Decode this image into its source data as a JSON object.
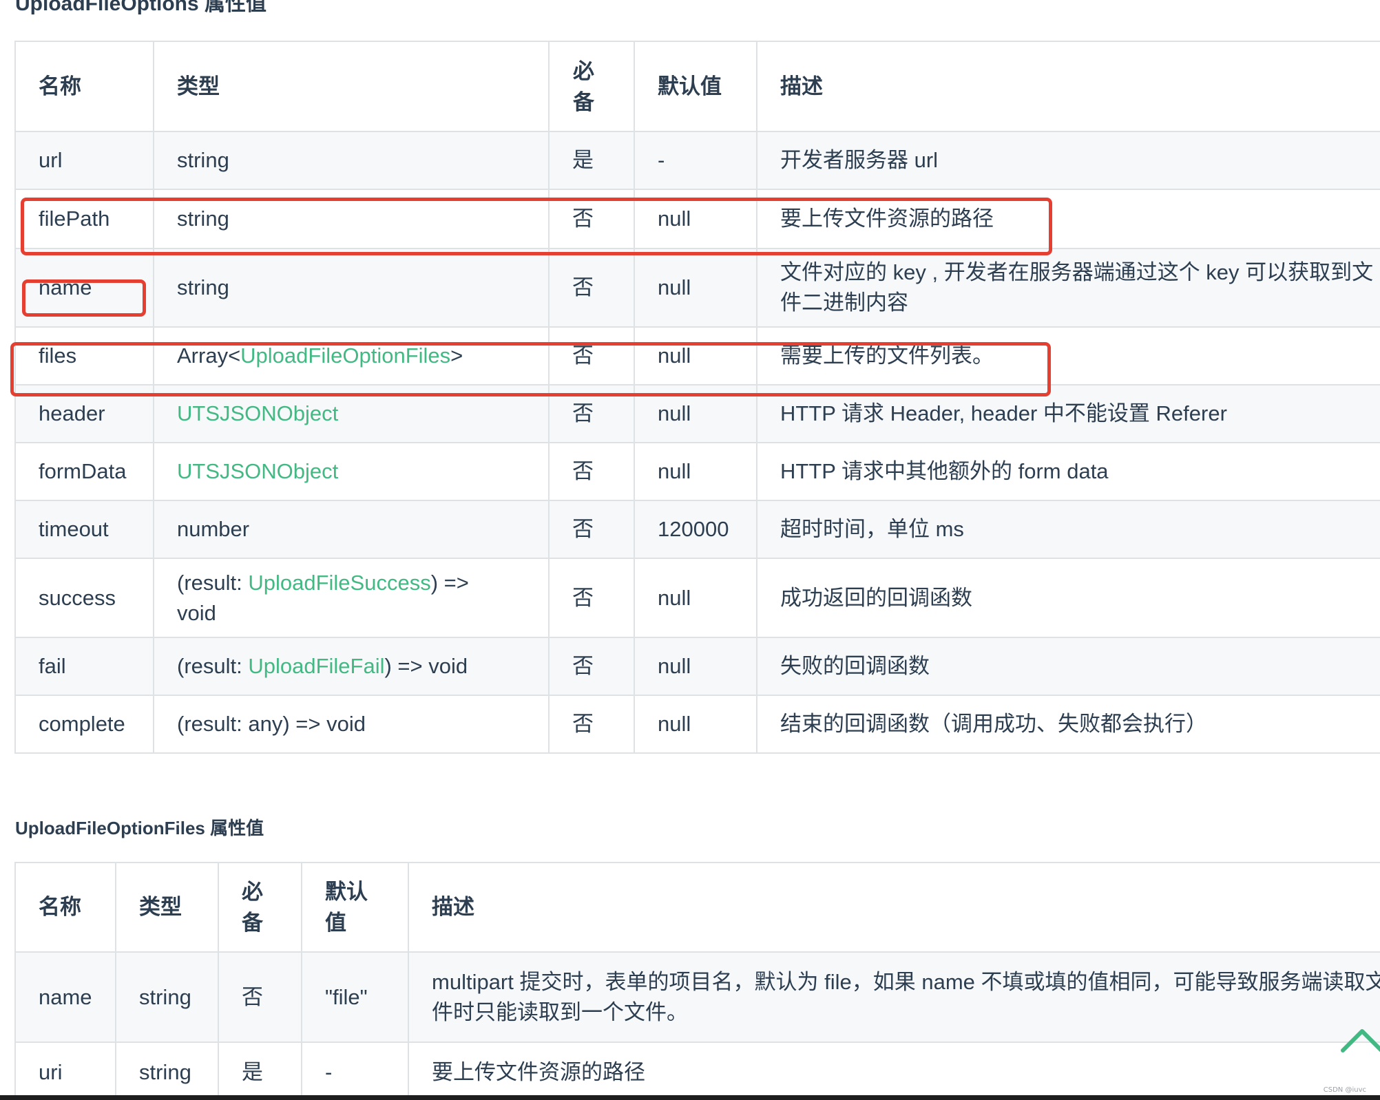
{
  "section1": {
    "title": "UploadFileOptions 属性值",
    "headers": [
      "名称",
      "类型",
      "必备",
      "默认值",
      "描述"
    ],
    "rows": [
      {
        "name": "url",
        "type_parts": [
          {
            "text": "string",
            "link": false
          }
        ],
        "required": "是",
        "default": "-",
        "desc": "开发者服务器 url"
      },
      {
        "name": "filePath",
        "type_parts": [
          {
            "text": "string",
            "link": false
          }
        ],
        "required": "否",
        "default": "null",
        "desc": "要上传文件资源的路径"
      },
      {
        "name": "name",
        "type_parts": [
          {
            "text": "string",
            "link": false
          }
        ],
        "required": "否",
        "default": "null",
        "desc": "文件对应的 key , 开发者在服务器端通过这个 key 可以获取到文件二进制内容"
      },
      {
        "name": "files",
        "type_parts": [
          {
            "text": "Array<",
            "link": false
          },
          {
            "text": "UploadFileOptionFiles",
            "link": true
          },
          {
            "text": ">",
            "link": false
          }
        ],
        "required": "否",
        "default": "null",
        "desc": "需要上传的文件列表。"
      },
      {
        "name": "header",
        "type_parts": [
          {
            "text": "UTSJSONObject",
            "link": true
          }
        ],
        "required": "否",
        "default": "null",
        "desc": "HTTP 请求 Header, header 中不能设置 Referer"
      },
      {
        "name": "formData",
        "type_parts": [
          {
            "text": "UTSJSONObject",
            "link": true
          }
        ],
        "required": "否",
        "default": "null",
        "desc": "HTTP 请求中其他额外的 form data"
      },
      {
        "name": "timeout",
        "type_parts": [
          {
            "text": "number",
            "link": false
          }
        ],
        "required": "否",
        "default": "120000",
        "desc": "超时时间，单位 ms"
      },
      {
        "name": "success",
        "type_parts": [
          {
            "text": "(result: ",
            "link": false
          },
          {
            "text": "UploadFileSuccess",
            "link": true
          },
          {
            "text": ") => void",
            "link": false
          }
        ],
        "required": "否",
        "default": "null",
        "desc": "成功返回的回调函数"
      },
      {
        "name": "fail",
        "type_parts": [
          {
            "text": "(result: ",
            "link": false
          },
          {
            "text": "UploadFileFail",
            "link": true
          },
          {
            "text": ") => void",
            "link": false
          }
        ],
        "required": "否",
        "default": "null",
        "desc": "失败的回调函数"
      },
      {
        "name": "complete",
        "type_parts": [
          {
            "text": "(result: any) => void",
            "link": false
          }
        ],
        "required": "否",
        "default": "null",
        "desc": "结束的回调函数（调用成功、失败都会执行）"
      }
    ]
  },
  "section2": {
    "title": "UploadFileOptionFiles 属性值",
    "headers": [
      "名称",
      "类型",
      "必备",
      "默认值",
      "描述"
    ],
    "rows": [
      {
        "name": "name",
        "type_parts": [
          {
            "text": "string",
            "link": false
          }
        ],
        "required": "否",
        "default": "\"file\"",
        "desc": "multipart 提交时，表单的项目名，默认为 file，如果 name 不填或填的值相同，可能导致服务端读取文件时只能读取到一个文件。"
      },
      {
        "name": "uri",
        "type_parts": [
          {
            "text": "string",
            "link": false
          }
        ],
        "required": "是",
        "default": "-",
        "desc": "要上传文件资源的路径"
      }
    ]
  },
  "colors": {
    "link": "#42b983",
    "highlight": "#e53f32",
    "text": "#2c3e50",
    "border": "#dfe2e5",
    "stripe": "#f6f8fa"
  },
  "icons": {
    "back_to_top": "chevron-up-icon"
  },
  "watermark": "CSDN @iuvc"
}
